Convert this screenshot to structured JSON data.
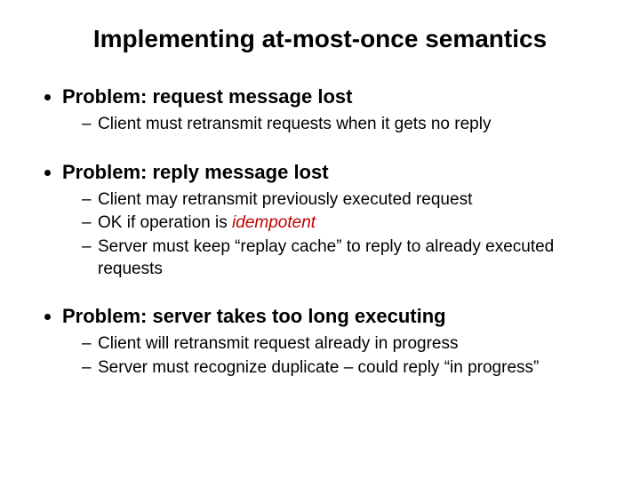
{
  "title": "Implementing at-most-once semantics",
  "bullets": [
    {
      "heading": "Problem: request message lost",
      "subs": [
        {
          "text": "Client must retransmit requests when it gets no reply"
        }
      ]
    },
    {
      "heading": "Problem: reply message lost",
      "subs": [
        {
          "text": "Client may retransmit previously executed request"
        },
        {
          "prefix": "OK if operation is ",
          "term": "idempotent"
        },
        {
          "text": "Server must keep “replay cache” to reply to already executed requests"
        }
      ]
    },
    {
      "heading": "Problem: server takes too long executing",
      "subs": [
        {
          "text": "Client will retransmit request already in progress"
        },
        {
          "text": "Server must recognize duplicate – could reply “in progress”"
        }
      ]
    }
  ]
}
